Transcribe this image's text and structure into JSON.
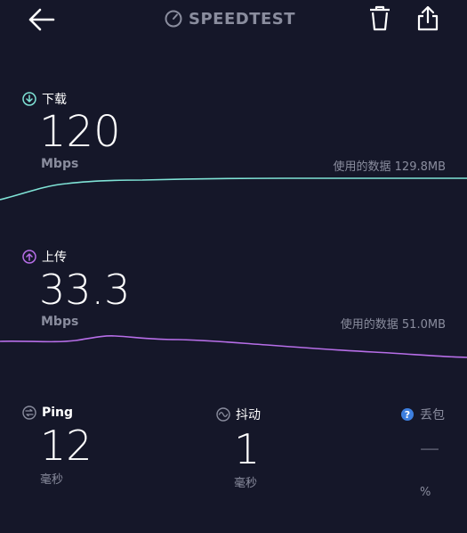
{
  "header": {
    "title": "SPEEDTEST",
    "back_icon": "arrow-left-icon",
    "trash_icon": "trash-icon",
    "share_icon": "share-icon",
    "brand_icon": "gauge-icon"
  },
  "download": {
    "label": "下载",
    "value": "120",
    "unit": "Mbps",
    "data_used": "使用的数据 129.8MB",
    "color": "#7fe3d6"
  },
  "upload": {
    "label": "上传",
    "value": "33.3",
    "unit": "Mbps",
    "data_used": "使用的数据 51.0MB",
    "color": "#b76ee8"
  },
  "ping": {
    "label": "Ping",
    "value": "12",
    "unit": "毫秒"
  },
  "jitter": {
    "label": "抖动",
    "value": "1",
    "unit": "毫秒"
  },
  "loss": {
    "label": "丢包",
    "value": "—",
    "unit": "%"
  }
}
